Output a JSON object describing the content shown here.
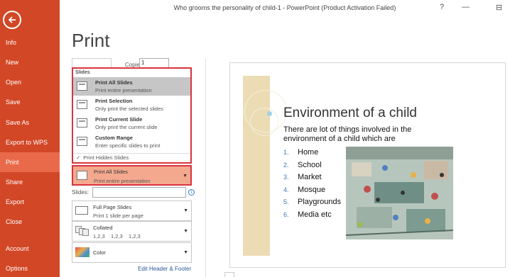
{
  "window": {
    "title": "Who grooms the personality of child-1 - PowerPoint (Product Activation Failed)",
    "help": "?",
    "minimize": "—",
    "restore": "⊟"
  },
  "sidebar": {
    "items": [
      {
        "label": "Info"
      },
      {
        "label": "New"
      },
      {
        "label": "Open"
      },
      {
        "label": "Save"
      },
      {
        "label": "Save As"
      },
      {
        "label": "Export to WPS PDF"
      },
      {
        "label": "Print",
        "active": true
      },
      {
        "label": "Share"
      },
      {
        "label": "Export"
      },
      {
        "label": "Close"
      },
      {
        "label": "Account"
      },
      {
        "label": "Options"
      }
    ],
    "accent": "#d24726"
  },
  "page": {
    "title": "Print"
  },
  "copies": {
    "label": "Copies:",
    "value": "1"
  },
  "range_menu": {
    "section": "Slides",
    "options": [
      {
        "title": "Print All Slides",
        "desc": "Print entire presentation",
        "selected": true
      },
      {
        "title": "Print Selection",
        "desc": "Only print the selected slides"
      },
      {
        "title": "Print Current Slide",
        "desc": "Only print the current slide"
      },
      {
        "title": "Custom Range",
        "desc": "Enter specific slides to print"
      }
    ],
    "hidden": {
      "check": "✓",
      "label": "Print Hidden Slides"
    }
  },
  "range_dropdown": {
    "title": "Print All Slides",
    "desc": "Print entire presentation"
  },
  "slides_field": {
    "label": "Slides:",
    "value": "",
    "info": "i"
  },
  "layout_dropdown": {
    "title": "Full Page Slides",
    "desc": "Print 1 slide per page"
  },
  "collate_dropdown": {
    "title": "Collated",
    "desc": "1,2,3    1,2,3    1,2,3"
  },
  "color_dropdown": {
    "title": "Color"
  },
  "edit_header_footer": "Edit Header & Footer",
  "slide": {
    "title": "Environment of a child",
    "intro": "There are lot of things involved in the environment of a child which are",
    "items": [
      {
        "num": "1.",
        "text": "Home"
      },
      {
        "num": "2.",
        "text": "School"
      },
      {
        "num": "3.",
        "text": "Market"
      },
      {
        "num": "4.",
        "text": "Mosque"
      },
      {
        "num": "5.",
        "text": "Playgrounds"
      },
      {
        "num": "6.",
        "text": "Media etc"
      }
    ]
  }
}
